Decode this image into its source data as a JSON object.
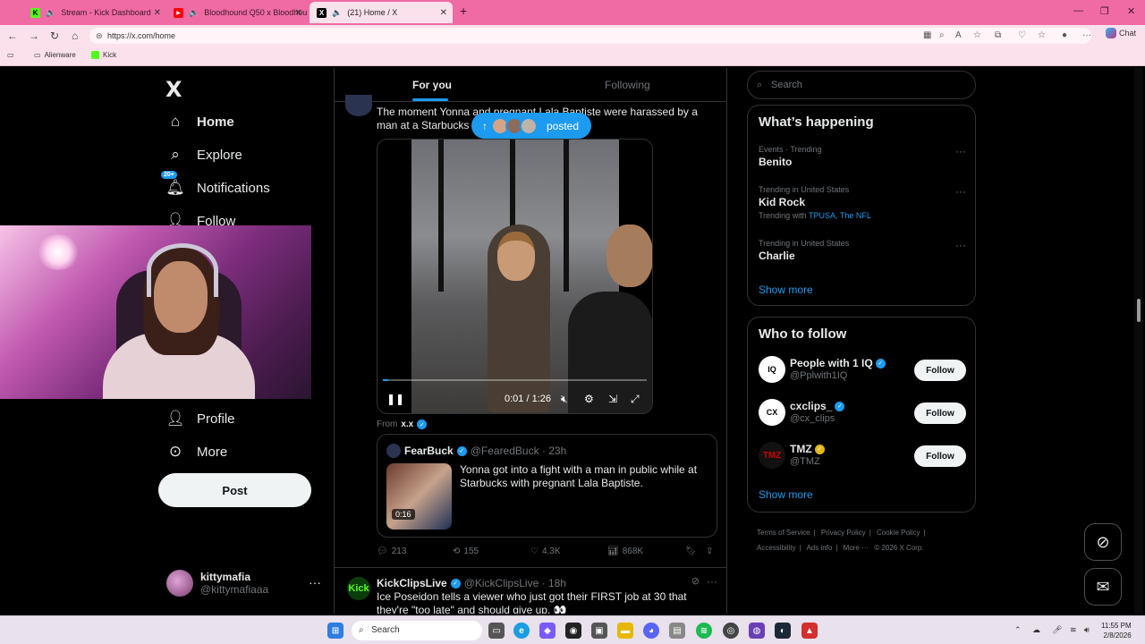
{
  "browser": {
    "tabs": [
      {
        "title": "Stream - Kick Dashboard",
        "icon": "kick-icon"
      },
      {
        "title": "Bloodhound Q50 x Bloodhou",
        "icon": "youtube-icon"
      },
      {
        "title": "(21) Home / X",
        "icon": "x-icon"
      }
    ],
    "new_tab": "+",
    "url": "https://x.com/home",
    "chat_label": "Chat",
    "bookmarks": [
      {
        "label": "Alienware"
      },
      {
        "label": "Kick"
      }
    ]
  },
  "nav": {
    "logo": "X",
    "items": [
      {
        "label": "Home",
        "icon": "home-icon"
      },
      {
        "label": "Explore",
        "icon": "search-icon"
      },
      {
        "label": "Notifications",
        "icon": "bell-icon",
        "badge": "20+"
      },
      {
        "label": "Follow",
        "icon": "person-add-icon"
      },
      {
        "label": "Profile",
        "icon": "person-icon"
      },
      {
        "label": "More",
        "icon": "more-circle-icon"
      }
    ],
    "post_button": "Post",
    "user": {
      "name": "kittymafia",
      "handle": "@kittymafiaaa"
    }
  },
  "feed": {
    "tabs": [
      "For you",
      "Following"
    ],
    "tweet1": {
      "text": "The moment Yonna and pregnant Lala Baptiste were harassed by a man at a Starbucks with no s",
      "posted_pill": "posted",
      "video": {
        "time": "0:01 / 1:26",
        "progress": 0.02
      },
      "from_label": "From",
      "from_user": "x.x",
      "quote": {
        "name": "FearBuck",
        "handle": "@FearedBuck · 23h",
        "text": "Yonna got into a fight with a man in public while at Starbucks with pregnant Lala Baptiste.",
        "duration": "0:16"
      },
      "stats": {
        "replies": "213",
        "reposts": "155",
        "likes": "4.3K",
        "views": "868K"
      }
    },
    "tweet2": {
      "avatar_text": "Kick",
      "name": "KickClipsLive",
      "handle": "@KickClipsLive · 18h",
      "text": "Ice Poseidon tells a viewer who just got their FIRST job at 30 that they're \"too late\" and should give up. 👀"
    }
  },
  "sidebar": {
    "search_placeholder": "Search",
    "happening": {
      "title": "What’s happening",
      "trends": [
        {
          "meta": "Events · Trending",
          "name": "Benito"
        },
        {
          "meta": "Trending in United States",
          "name": "Kid Rock",
          "with_label": "Trending with",
          "with": "TPUSA, The NFL"
        },
        {
          "meta": "Trending in United States",
          "name": "Charlie"
        }
      ],
      "show_more": "Show more"
    },
    "who_to_follow": {
      "title": "Who to follow",
      "accounts": [
        {
          "name": "People with 1 IQ",
          "handle": "@Pplwith1IQ",
          "verified": "blue",
          "avatar": "IQ"
        },
        {
          "name": "cxclips_",
          "handle": "@cx_clips",
          "verified": "blue",
          "avatar": "CX"
        },
        {
          "name": "TMZ",
          "handle": "@TMZ",
          "verified": "gold",
          "avatar": "TMZ"
        }
      ],
      "follow_label": "Follow",
      "show_more": "Show more"
    },
    "footer": [
      "Terms of Service",
      "|",
      "Privacy Policy",
      "|",
      "Cookie Policy",
      "|",
      "Accessibility",
      "|",
      "Ads info",
      "|",
      "More ···",
      "© 2026 X Corp."
    ]
  },
  "taskbar": {
    "search": "Search",
    "time": "11:55 PM",
    "date": "2/8/2026"
  },
  "colors": {
    "accent": "#1d9bf0",
    "browser_tab_bg": "#f06aa4",
    "browser_toolbar_bg": "#fbe1ec",
    "background": "#000000"
  }
}
